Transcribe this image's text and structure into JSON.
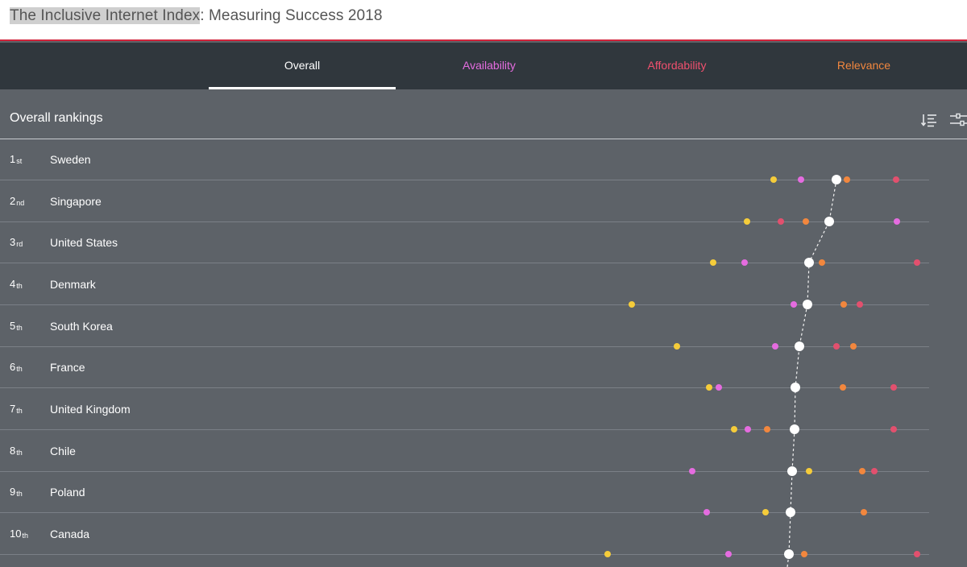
{
  "header": {
    "title_highlight": "The Inclusive Internet Index",
    "title_rest": ": Measuring Success 2018"
  },
  "tabs": [
    {
      "label": "Overall",
      "color": "#ffffff"
    },
    {
      "label": "Availability",
      "color": "#e56ce0"
    },
    {
      "label": "Affordability",
      "color": "#f0506e"
    },
    {
      "label": "Relevance",
      "color": "#f2873e"
    }
  ],
  "section": {
    "title": "Overall rankings",
    "sort_icon": "sort-list-icon",
    "filter_icon": "sliders-icon"
  },
  "colors": {
    "overall": "#ffffff",
    "readiness": "#f5cc3a",
    "availability": "#e56ce0",
    "affordability": "#e2506e",
    "relevance": "#f2873e",
    "background": "#5d6268",
    "tabbar": "#30373d"
  },
  "rows": [
    {
      "rank": "1",
      "suffix": "st",
      "country": "Sweden",
      "dots": {
        "overall": 1038,
        "readiness": 960,
        "availability": 994,
        "relevance": 1051,
        "affordability": 1112
      }
    },
    {
      "rank": "2",
      "suffix": "nd",
      "country": "Singapore",
      "dots": {
        "overall": 1029,
        "readiness": 927,
        "affordability": 969,
        "relevance": 1000,
        "availability": 1113
      }
    },
    {
      "rank": "3",
      "suffix": "rd",
      "country": "United States",
      "dots": {
        "overall": 1004,
        "readiness": 885,
        "availability": 924,
        "relevance": 1020,
        "affordability": 1138
      }
    },
    {
      "rank": "4",
      "suffix": "th",
      "country": "Denmark",
      "dots": {
        "overall": 1002,
        "readiness": 784,
        "availability": 985,
        "relevance": 1047,
        "affordability": 1067
      }
    },
    {
      "rank": "5",
      "suffix": "th",
      "country": "South Korea",
      "dots": {
        "overall": 992,
        "readiness": 840,
        "availability": 962,
        "affordability": 1038,
        "relevance": 1059
      }
    },
    {
      "rank": "6",
      "suffix": "th",
      "country": "France",
      "dots": {
        "overall": 987,
        "readiness": 880,
        "availability": 892,
        "relevance": 1046,
        "affordability": 1109
      }
    },
    {
      "rank": "7",
      "suffix": "th",
      "country": "United Kingdom",
      "dots": {
        "overall": 986,
        "readiness": 911,
        "availability": 928,
        "relevance": 952,
        "affordability": 1109
      }
    },
    {
      "rank": "8",
      "suffix": "th",
      "country": "Chile",
      "dots": {
        "overall": 983,
        "availability": 859,
        "readiness": 1004,
        "relevance": 1070,
        "affordability": 1085
      }
    },
    {
      "rank": "9",
      "suffix": "th",
      "country": "Poland",
      "dots": {
        "overall": 981,
        "availability": 877,
        "readiness": 950,
        "relevance": 1072
      }
    },
    {
      "rank": "10",
      "suffix": "th",
      "country": "Canada",
      "dots": {
        "overall": 979,
        "readiness": 754,
        "availability": 904,
        "relevance": 998,
        "affordability": 1138
      }
    }
  ]
}
